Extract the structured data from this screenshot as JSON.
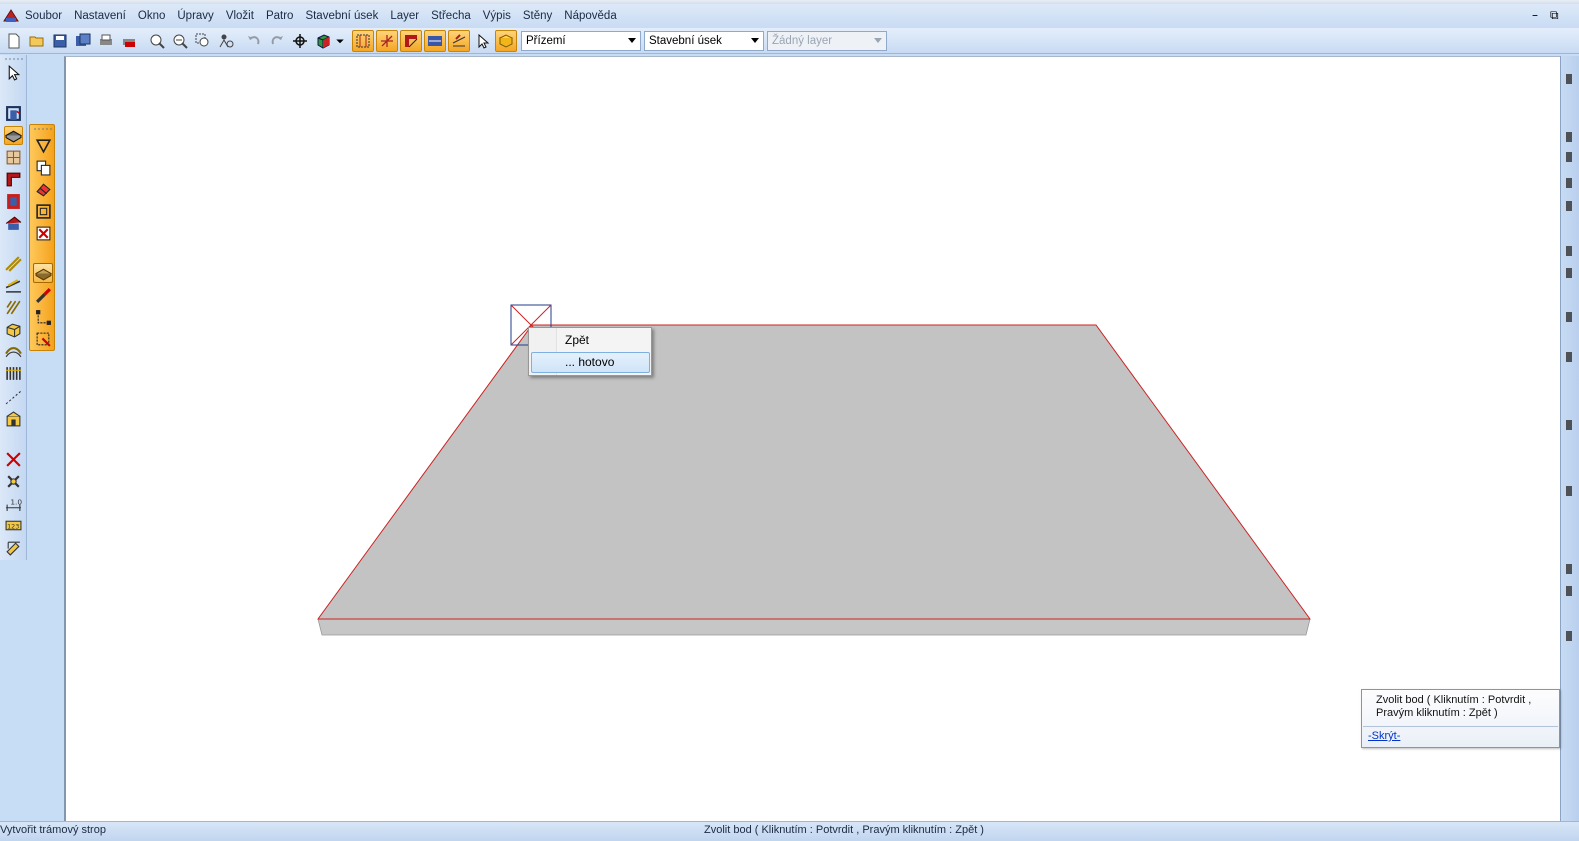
{
  "menu": [
    "Soubor",
    "Nastavení",
    "Okno",
    "Úpravy",
    "Vložit",
    "Patro",
    "Stavební úsek",
    "Layer",
    "Střecha",
    "Výpis",
    "Stěny",
    "Nápověda"
  ],
  "window_controls": {
    "minimize": "–",
    "restore": "⧉"
  },
  "toolbar": {
    "floor_select": "Přízemí",
    "section_select": "Stavební úsek",
    "layer_select": "Žádný layer"
  },
  "context_menu": {
    "items": [
      "Zpět",
      "... hotovo"
    ],
    "selected_index": 1
  },
  "hint": {
    "text": "Zvolit bod ( Kliknutím : Potvrdit , Pravým kliknutím : Zpět )",
    "hide_link": "-Skrýt-"
  },
  "status": {
    "left": "Vytvořit trámový strop",
    "center": "Zvolit bod ( Kliknutím : Potvrdit ,  Pravým kliknutím : Zpět )"
  },
  "colors": {
    "slab_fill": "#c3c3c3",
    "slab_edge": "#cc2222",
    "highlight": "#f5a623"
  },
  "icons": {
    "toolbar": [
      "new-file-icon",
      "open-folder-icon",
      "save-icon",
      "save-all-icon",
      "print-icon",
      "pdf-icon",
      "zoom-in-icon",
      "zoom-out-icon",
      "zoom-window-icon",
      "zoom-person-icon",
      "undo-icon",
      "redo-icon",
      "crosshair-icon",
      "3d-cube-icon",
      "dropdown-arrow-icon",
      "grid-select-icon",
      "snap-point-icon",
      "wall-corner-icon",
      "layer-view-icon",
      "dimension-icon",
      "pointer-icon",
      "floor-select-icon"
    ],
    "left": [
      "select-arrow-icon",
      "open-door-icon",
      "floor-slab-icon",
      "window-grid-icon",
      "wall-corner-icon",
      "red-frame-icon",
      "house-roof-icon",
      "diagonal-lines-icon",
      "angle-lines-icon",
      "hatch-lines-icon",
      "box-3d-icon",
      "arch-icon",
      "fence-icon",
      "dotted-line-icon",
      "shed-icon",
      "delete-x-icon",
      "tools-icon",
      "dimension-1-icon",
      "measure-icon",
      "ruler-pencil-icon"
    ],
    "orange": [
      "triangle-down-icon",
      "copy-icon",
      "eraser-icon",
      "square-icon",
      "delete-icon",
      "slab-3d-icon",
      "brush-icon",
      "corner-node-icon",
      "edit-arrow-icon"
    ]
  }
}
